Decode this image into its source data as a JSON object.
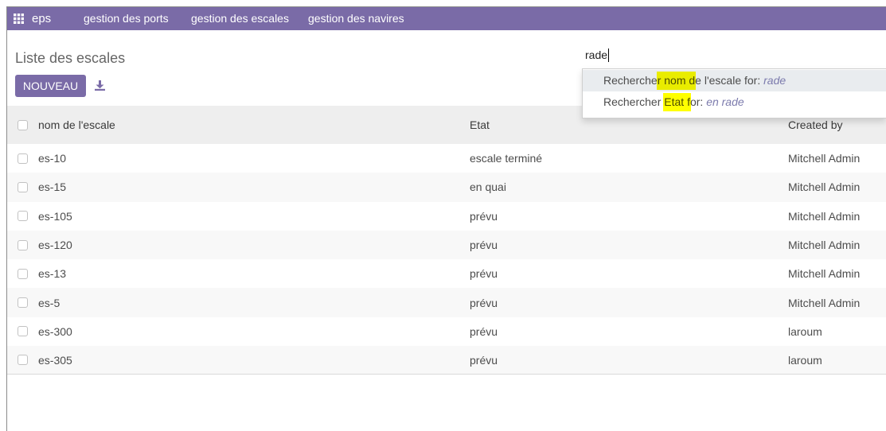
{
  "nav": {
    "apps_icon": "apps-grid-icon",
    "app_name": "eps",
    "menu": [
      {
        "label": "gestion des ports"
      },
      {
        "label": "gestion des escales"
      },
      {
        "label": "gestion des navires"
      }
    ]
  },
  "control_panel": {
    "breadcrumb": "Liste des escales",
    "new_button_label": "NOUVEAU",
    "export_icon": "download-icon",
    "search": {
      "value": "rade"
    }
  },
  "search_autocomplete": {
    "items": [
      {
        "prefix": "Rechercher",
        "field": "nom de l'escale",
        "connector": "for:",
        "value": "rade",
        "active": true
      },
      {
        "prefix": "Rechercher",
        "field": "Etat",
        "connector": "for:",
        "value": "en rade",
        "active": false
      }
    ]
  },
  "list": {
    "columns": {
      "name": "nom de l'escale",
      "state": "Etat",
      "created_by": "Created by"
    },
    "rows": [
      {
        "name": "es-10",
        "state": "escale terminé",
        "created_by": "Mitchell Admin"
      },
      {
        "name": "es-15",
        "state": "en quai",
        "created_by": "Mitchell Admin"
      },
      {
        "name": "es-105",
        "state": "prévu",
        "created_by": "Mitchell Admin"
      },
      {
        "name": "es-120",
        "state": "prévu",
        "created_by": "Mitchell Admin"
      },
      {
        "name": "es-13",
        "state": "prévu",
        "created_by": "Mitchell Admin"
      },
      {
        "name": "es-5",
        "state": "prévu",
        "created_by": "Mitchell Admin"
      },
      {
        "name": "es-300",
        "state": "prévu",
        "created_by": "laroum"
      },
      {
        "name": "es-305",
        "state": "prévu",
        "created_by": "laroum"
      }
    ]
  },
  "colors": {
    "brand": "#7a6ba7",
    "autocomplete_value": "#7c7bad",
    "active_suggestion_bg": "#e9ecef",
    "annotation_highlight": "#ffff00",
    "list_header_bg": "#eeeeee",
    "striped_row_bg": "#f8f8f8"
  }
}
